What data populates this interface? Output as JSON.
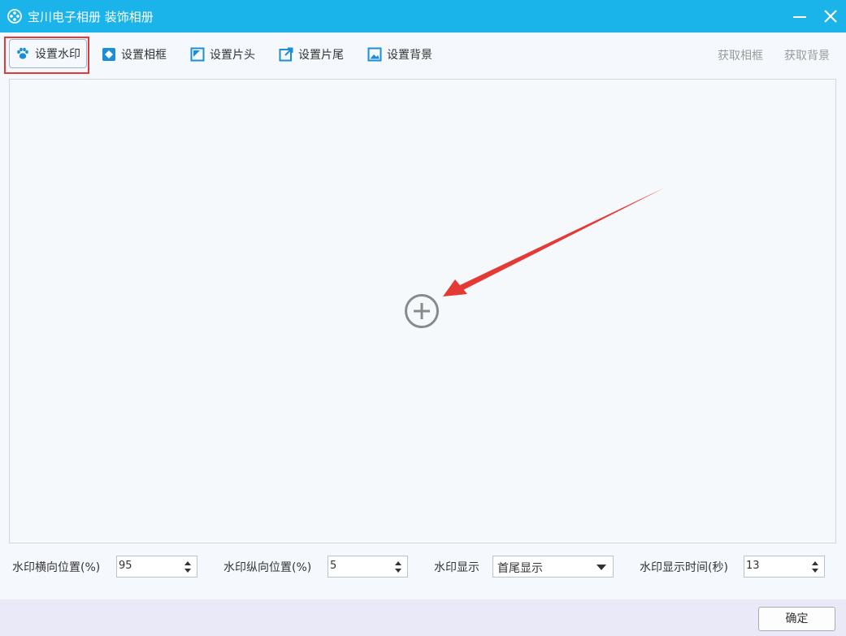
{
  "window": {
    "title": "宝川电子相册 装饰相册",
    "title_bar_color": "#1ab3ea"
  },
  "tabs": [
    {
      "label": "设置水印",
      "icon": "paw-icon",
      "selected": true
    },
    {
      "label": "设置相框",
      "icon": "frame-icon"
    },
    {
      "label": "设置片头",
      "icon": "intro-icon"
    },
    {
      "label": "设置片尾",
      "icon": "outro-icon"
    },
    {
      "label": "设置背景",
      "icon": "image-icon"
    }
  ],
  "links": {
    "get_frame": "获取相框",
    "get_background": "获取背景"
  },
  "canvas": {
    "add_icon": "plus-circle-icon",
    "annotation_arrow_color": "#e53935"
  },
  "controls": {
    "h_position_label": "水印横向位置(%)",
    "h_position_value": "95",
    "v_position_label": "水印纵向位置(%)",
    "v_position_value": "5",
    "display_label": "水印显示",
    "display_value": "首尾显示",
    "duration_label": "水印显示时间(秒)",
    "duration_value": "13"
  },
  "footer": {
    "ok_label": "确定"
  },
  "accent_color": "#1a8fd8"
}
